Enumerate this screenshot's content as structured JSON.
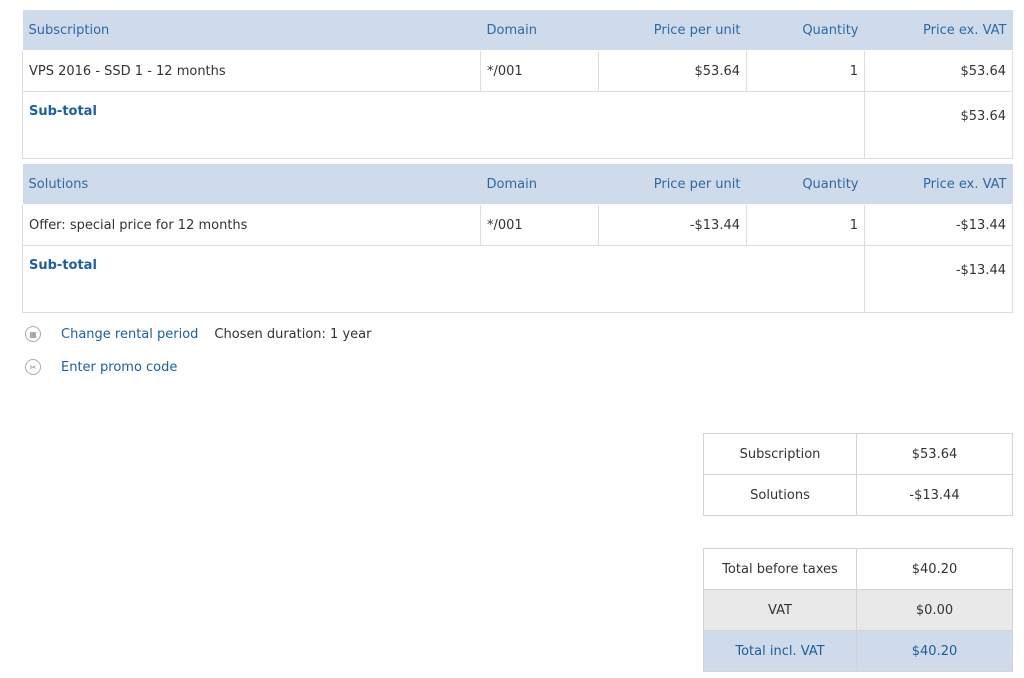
{
  "subscriptions": {
    "headers": [
      "Subscription",
      "Domain",
      "Price per unit",
      "Quantity",
      "Price ex. VAT"
    ],
    "rows": [
      {
        "name": "VPS 2016 - SSD 1 - 12 months",
        "domain": "*/001",
        "unit_price": "$53.64",
        "quantity": "1",
        "price_ex_vat": "$53.64"
      }
    ],
    "subtotal_label": "Sub-total",
    "subtotal_value": "$53.64"
  },
  "solutions": {
    "headers": [
      "Solutions",
      "Domain",
      "Price per unit",
      "Quantity",
      "Price ex. VAT"
    ],
    "rows": [
      {
        "name": "Offer: special price for 12 months",
        "domain": "*/001",
        "unit_price": "-$13.44",
        "quantity": "1",
        "price_ex_vat": "-$13.44"
      }
    ],
    "subtotal_label": "Sub-total",
    "subtotal_value": "-$13.44"
  },
  "actions": {
    "change_rental_label": "Change rental period",
    "chosen_duration": "Chosen duration: 1 year",
    "promo_label": "Enter promo code"
  },
  "summary": {
    "subscription_label": "Subscription",
    "subscription_value": "$53.64",
    "solutions_label": "Solutions",
    "solutions_value": "-$13.44"
  },
  "totals": {
    "before_taxes_label": "Total before taxes",
    "before_taxes_value": "$40.20",
    "vat_label": "VAT",
    "vat_value": "$0.00",
    "total_label": "Total incl. VAT",
    "total_value": "$40.20"
  },
  "colors": {
    "header_bg": "#cfdaea",
    "accent": "#1a5f9e",
    "vat_bg": "#e9e9e9"
  },
  "icons": {
    "rental": "calendar-icon",
    "promo": "scissors-icon"
  }
}
